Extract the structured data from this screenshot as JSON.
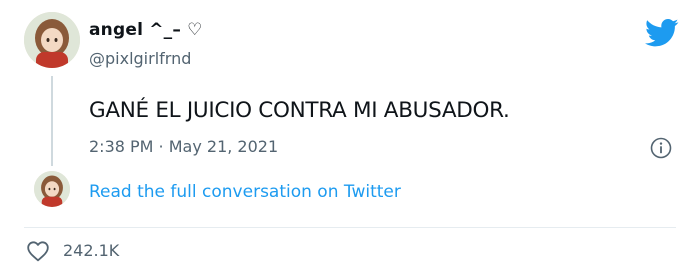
{
  "tweet": {
    "display_name": "angel ^_– ♡",
    "username": "@pixlgirlfrnd",
    "text": "GANÉ EL JUICIO CONTRA MI ABUSADOR.",
    "timestamp": "2:38 PM · May 21, 2021"
  },
  "conversation_link": "Read the full conversation on Twitter",
  "engagement": {
    "likes": "242.1K"
  },
  "icons": {
    "brand": "twitter-bird-icon",
    "info": "info-icon",
    "like": "heart-icon"
  },
  "colors": {
    "brand_blue": "#1d9bf0",
    "secondary_text": "#536471",
    "primary_text": "#0f1419"
  }
}
